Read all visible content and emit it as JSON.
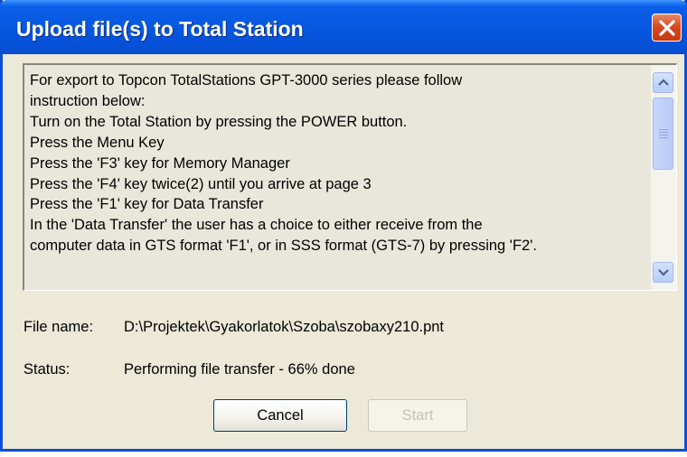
{
  "dialog": {
    "title": "Upload file(s) to Total Station",
    "close_icon": "close-icon"
  },
  "instructions": {
    "lines": [
      "For export to Topcon TotalStations GPT-3000 series please follow",
      "instruction below:",
      "Turn on the Total Station by pressing the POWER button.",
      "Press the Menu Key",
      "Press the 'F3' key for Memory Manager",
      "Press the 'F4' key twice(2) until you arrive at page 3",
      "Press the 'F1' key for Data Transfer",
      "In the 'Data Transfer' the user has a choice to either receive from the",
      "computer data in GTS format 'F1', or in SSS format (GTS-7) by pressing 'F2'."
    ]
  },
  "file": {
    "label": "File name:",
    "value": "D:\\Projektek\\Gyakorlatok\\Szoba\\szobaxy210.pnt"
  },
  "status": {
    "label": "Status:",
    "value": "Performing file transfer - 66% done"
  },
  "buttons": {
    "cancel_label": "Cancel",
    "start_label": "Start"
  },
  "colors": {
    "titlebar": "#0858e0",
    "dialog_bg": "#ece9d8",
    "close_button": "#d5461f"
  }
}
